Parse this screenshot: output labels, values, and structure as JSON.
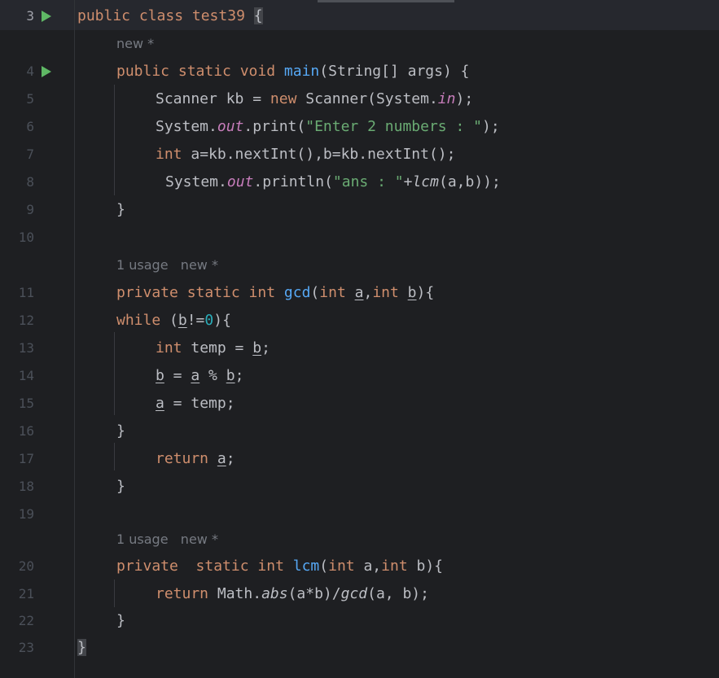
{
  "gutter": {
    "lines": [
      "3",
      "4",
      "5",
      "6",
      "7",
      "8",
      "9",
      "10",
      "11",
      "12",
      "13",
      "14",
      "15",
      "16",
      "17",
      "18",
      "19",
      "20",
      "21",
      "22",
      "23"
    ]
  },
  "hints": {
    "class_main": "new *",
    "gcd": "1 usage   new *",
    "lcm": "1 usage   new *"
  },
  "code": [
    {
      "name": "line-3",
      "tokens": [
        "public class test39 ",
        "{"
      ]
    },
    {
      "name": "line-4",
      "tokens": [
        "public static void ",
        "main",
        "(String[] args) {"
      ]
    },
    {
      "name": "line-5",
      "tokens": [
        "Scanner kb = ",
        "new",
        " Scanner(System.",
        "in",
        ");"
      ]
    },
    {
      "name": "line-6",
      "tokens": [
        "System.",
        "out",
        ".print(",
        "\"Enter 2 numbers : \"",
        ");"
      ]
    },
    {
      "name": "line-7",
      "tokens": [
        "int",
        " a=kb.nextInt(),b=kb.nextInt();"
      ]
    },
    {
      "name": "line-8",
      "tokens": [
        "System.",
        "out",
        ".println(",
        "\"ans : \"",
        "+",
        "lcm",
        "(a,b));"
      ]
    },
    {
      "name": "line-9",
      "tokens": [
        "}"
      ]
    },
    {
      "name": "line-10",
      "tokens": []
    },
    {
      "name": "line-11",
      "tokens": [
        "private static int ",
        "gcd",
        "(",
        "int",
        " ",
        "a",
        ",",
        "int",
        " ",
        "b",
        "){"
      ]
    },
    {
      "name": "line-12",
      "tokens": [
        "while",
        " (",
        "b",
        "!=",
        "0",
        "){"
      ]
    },
    {
      "name": "line-13",
      "tokens": [
        "int",
        " temp = ",
        "b",
        ";"
      ]
    },
    {
      "name": "line-14",
      "tokens": [
        "b",
        " = ",
        "a",
        " % ",
        "b",
        ";"
      ]
    },
    {
      "name": "line-15",
      "tokens": [
        "a",
        " = temp;"
      ]
    },
    {
      "name": "line-16",
      "tokens": [
        "}"
      ]
    },
    {
      "name": "line-17",
      "tokens": [
        "return",
        " ",
        "a",
        ";"
      ]
    },
    {
      "name": "line-18",
      "tokens": [
        "}"
      ]
    },
    {
      "name": "line-19",
      "tokens": []
    },
    {
      "name": "line-20",
      "tokens": [
        "private  static int ",
        "lcm",
        "(",
        "int",
        " a,",
        "int",
        " b){"
      ]
    },
    {
      "name": "line-21",
      "tokens": [
        "return",
        " Math.",
        "abs",
        "(a*b)/",
        "gcd",
        "(a, b);"
      ]
    },
    {
      "name": "line-22",
      "tokens": [
        "}"
      ]
    },
    {
      "name": "line-23",
      "tokens": [
        "}"
      ]
    }
  ],
  "colors": {
    "background": "#1e1f22",
    "keyword": "#cf8e6d",
    "method_declaration": "#56a8f5",
    "string": "#6aab73",
    "static_field": "#c77dbb",
    "number": "#2aacb8",
    "run_gutter_icon": "#5fb865"
  }
}
